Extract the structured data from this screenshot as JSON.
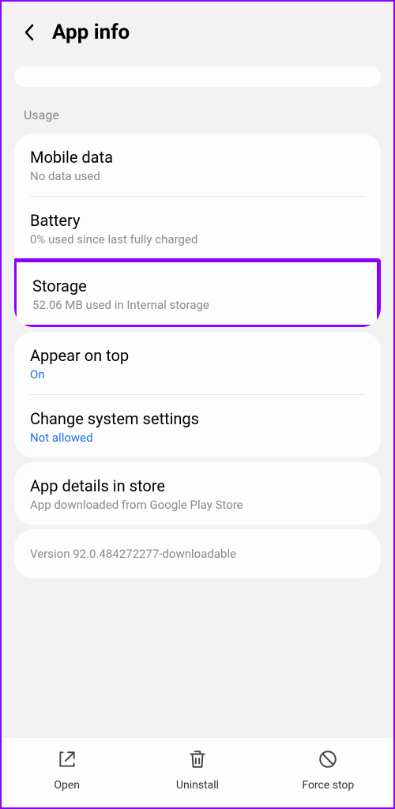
{
  "header": {
    "title": "App info"
  },
  "usage": {
    "label": "Usage",
    "mobile_data": {
      "title": "Mobile data",
      "sub": "No data used"
    },
    "battery": {
      "title": "Battery",
      "sub": "0% used since last fully charged"
    },
    "storage": {
      "title": "Storage",
      "sub": "52.06 MB used in Internal storage"
    }
  },
  "permissions": {
    "appear_on_top": {
      "title": "Appear on top",
      "sub": "On"
    },
    "change_settings": {
      "title": "Change system settings",
      "sub": "Not allowed"
    }
  },
  "store": {
    "title": "App details in store",
    "sub": "App downloaded from Google Play Store"
  },
  "version": {
    "text": "Version 92.0.484272277-downloadable"
  },
  "bottom": {
    "open": "Open",
    "uninstall": "Uninstall",
    "force_stop": "Force stop"
  }
}
